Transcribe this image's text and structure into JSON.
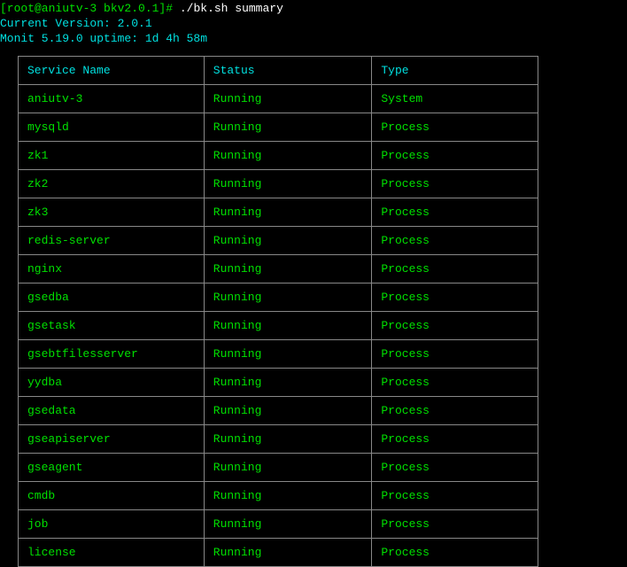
{
  "prompt": {
    "user_host": "[root@aniutv-3 bkv2.0.1]#",
    "command": "./bk.sh summary"
  },
  "header_lines": {
    "version_line": "Current Version: 2.0.1",
    "monit_line": "Monit 5.19.0 uptime: 1d 4h 58m"
  },
  "table": {
    "headers": {
      "service": "Service Name",
      "status": "Status",
      "type": "Type"
    },
    "rows": [
      {
        "service": "aniutv-3",
        "status": "Running",
        "type": "System"
      },
      {
        "service": "mysqld",
        "status": "Running",
        "type": "Process"
      },
      {
        "service": "zk1",
        "status": "Running",
        "type": "Process"
      },
      {
        "service": "zk2",
        "status": "Running",
        "type": "Process"
      },
      {
        "service": "zk3",
        "status": "Running",
        "type": "Process"
      },
      {
        "service": "redis-server",
        "status": "Running",
        "type": "Process"
      },
      {
        "service": "nginx",
        "status": "Running",
        "type": "Process"
      },
      {
        "service": "gsedba",
        "status": "Running",
        "type": "Process"
      },
      {
        "service": "gsetask",
        "status": "Running",
        "type": "Process"
      },
      {
        "service": "gsebtfilesserver",
        "status": "Running",
        "type": "Process"
      },
      {
        "service": "yydba",
        "status": "Running",
        "type": "Process"
      },
      {
        "service": "gsedata",
        "status": "Running",
        "type": "Process"
      },
      {
        "service": "gseapiserver",
        "status": "Running",
        "type": "Process"
      },
      {
        "service": "gseagent",
        "status": "Running",
        "type": "Process"
      },
      {
        "service": "cmdb",
        "status": "Running",
        "type": "Process"
      },
      {
        "service": "job",
        "status": "Running",
        "type": "Process"
      },
      {
        "service": "license",
        "status": "Running",
        "type": "Process"
      }
    ]
  }
}
